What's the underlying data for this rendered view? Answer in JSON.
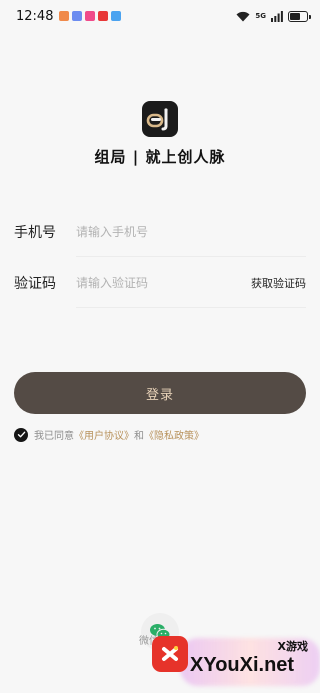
{
  "status_bar": {
    "time": "12:48",
    "app_icon_colors": [
      "#f08a4b",
      "#6c8cf0",
      "#f04b8a",
      "#e83838",
      "#4ba3f0"
    ],
    "network_label": "5G"
  },
  "header": {
    "slogan": "组局 | 就上创人脉"
  },
  "form": {
    "phone_label": "手机号",
    "phone_placeholder": "请输入手机号",
    "code_label": "验证码",
    "code_placeholder": "请输入验证码",
    "get_code_label": "获取验证码"
  },
  "login_button": "登录",
  "agreement": {
    "prefix": "我已同意",
    "user_agreement": "《用户协议》",
    "and": "和",
    "privacy_policy": "《隐私政策》"
  },
  "other_login": {
    "wechat_label": "微信"
  },
  "watermark": {
    "small_text": "X游戏",
    "site": "XYouXi.net"
  },
  "colors": {
    "login_button_bg": "#544b45",
    "login_button_text": "#e7d2b8",
    "link": "#b8925c",
    "wechat_green": "#2aae67"
  }
}
